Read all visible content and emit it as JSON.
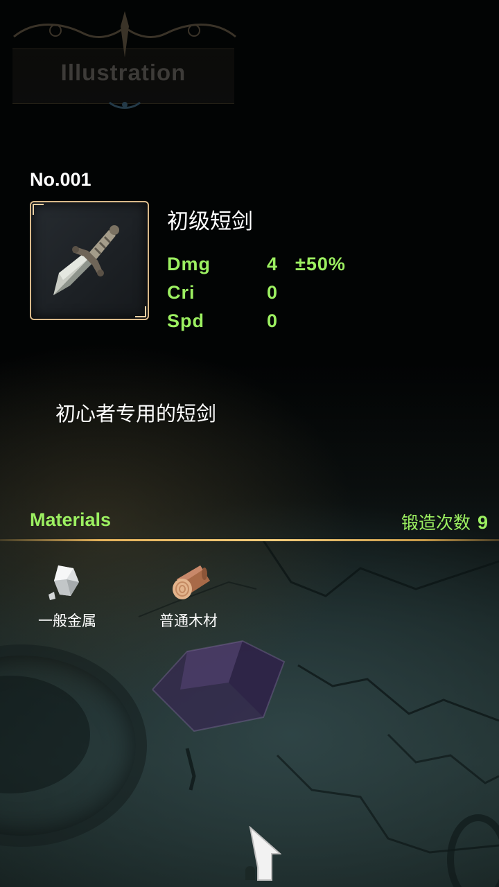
{
  "header": {
    "title": "Illustration"
  },
  "item": {
    "number": "No.001",
    "name": "初级短剑",
    "icon": "dagger-icon",
    "stats": [
      {
        "label": "Dmg",
        "value": "4",
        "extra": "±50%"
      },
      {
        "label": "Cri",
        "value": "0",
        "extra": ""
      },
      {
        "label": "Spd",
        "value": "0",
        "extra": ""
      }
    ],
    "description": "初心者专用的短剑"
  },
  "materials": {
    "title": "Materials",
    "forge_label": "锻造次数",
    "forge_count": "9",
    "items": [
      {
        "label": "一般金属",
        "icon": "metal-ore-icon"
      },
      {
        "label": "普通木材",
        "icon": "wood-log-icon"
      }
    ]
  },
  "footer": {
    "home_icon": "home-icon"
  },
  "colors": {
    "accent_green": "#9cf061",
    "frame_gold": "#d9b98a",
    "divider_gold": "#f5cd7c"
  }
}
